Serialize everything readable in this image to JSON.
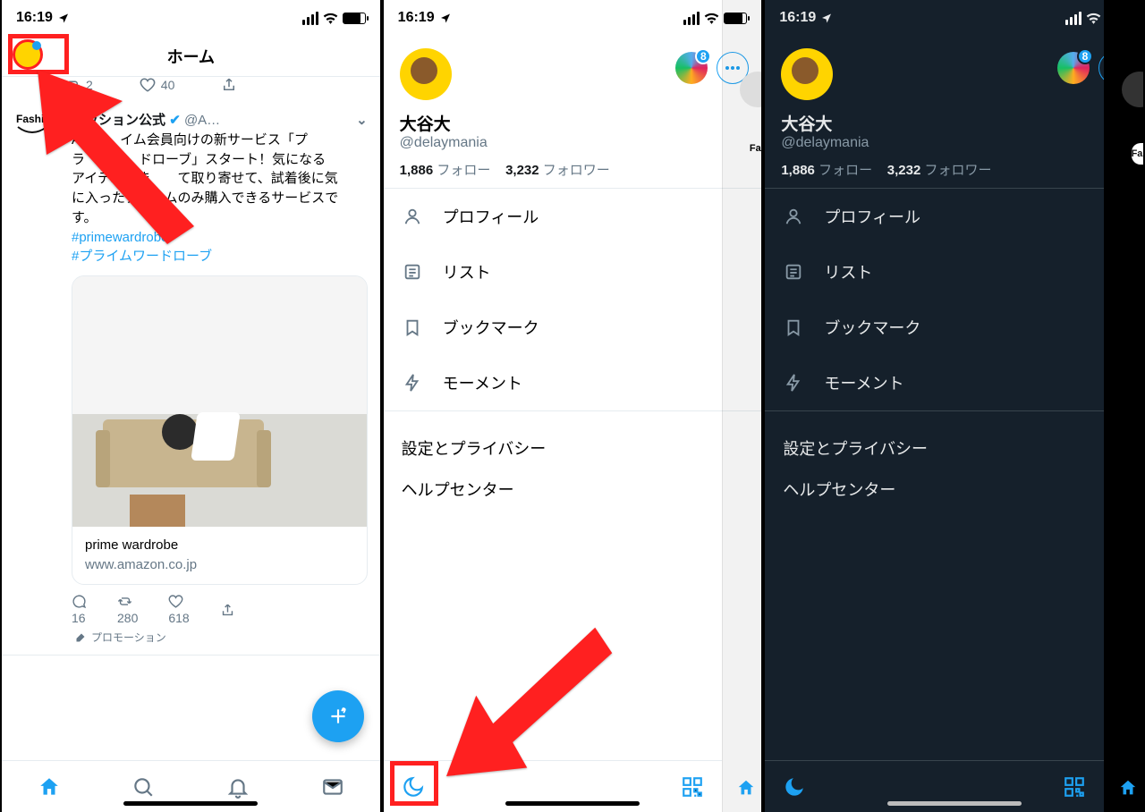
{
  "status_time": "16:19",
  "screens": {
    "home": {
      "title": "ホーム",
      "actions_top": {
        "rt": "2",
        "like": "40"
      },
      "tweet": {
        "avatar_label": "Fashion",
        "name": "ァッション公式",
        "verified": true,
        "handle": "@A…",
        "text_line1": "A　　　イム会員向けの新サービス「プ",
        "text_line2": "ラ　　　　ドローブ」スタート！気になる",
        "text_line3": "アイテムをま　　て取り寄せて、試着後に気",
        "text_line4": "に入ったアイテムのみ購入できるサービスで",
        "text_line5": "す。",
        "hashtag1": "#primewardrobe",
        "hashtag2": "#プライムワードローブ",
        "card_title": "prime wardrobe",
        "card_url": "www.amazon.co.jp",
        "reply": "16",
        "rt": "280",
        "like": "618",
        "promo": "プロモーション"
      }
    },
    "drawer": {
      "name": "大谷大",
      "handle": "@delaymania",
      "following_n": "1,886",
      "following_l": "フォロー",
      "followers_n": "3,232",
      "followers_l": "フォロワー",
      "badge": "8",
      "m_profile": "プロフィール",
      "m_list": "リスト",
      "m_bookmark": "ブックマーク",
      "m_moment": "モーメント",
      "s_settings": "設定とプライバシー",
      "s_help": "ヘルプセンター"
    }
  }
}
